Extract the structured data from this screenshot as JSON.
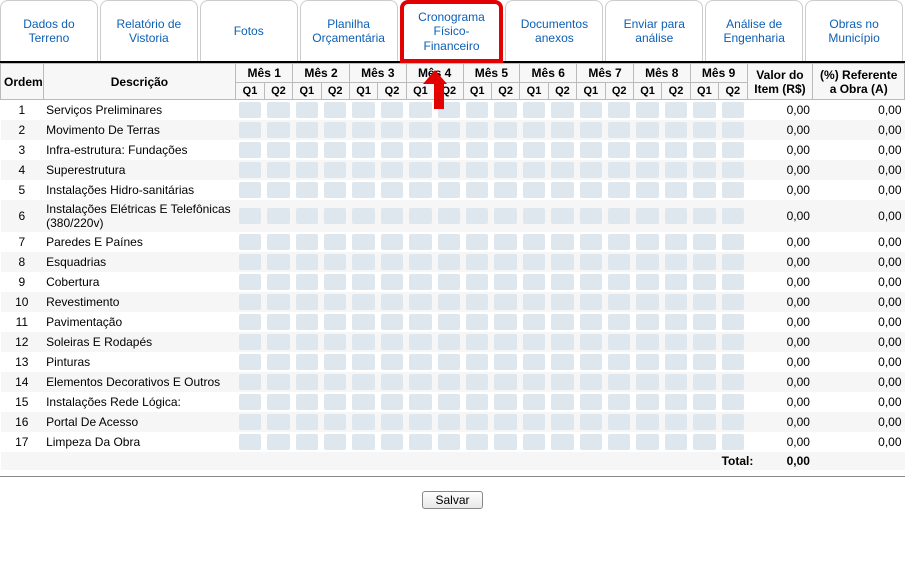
{
  "tabs": [
    {
      "label": "Dados do Terreno"
    },
    {
      "label": "Relatório de Vistoria"
    },
    {
      "label": "Fotos"
    },
    {
      "label": "Planilha Orçamentária"
    },
    {
      "label": "Cronograma Físico-Financeiro",
      "active": true
    },
    {
      "label": "Documentos anexos"
    },
    {
      "label": "Enviar para análise"
    },
    {
      "label": "Análise de Engenharia"
    },
    {
      "label": "Obras no Município"
    }
  ],
  "headers": {
    "ordem": "Ordem",
    "descricao": "Descrição",
    "meses": [
      "Mês 1",
      "Mês 2",
      "Mês 3",
      "Mês 4",
      "Mês 5",
      "Mês 6",
      "Mês 7",
      "Mês 8",
      "Mês 9"
    ],
    "quinzenas": [
      "Q1",
      "Q2"
    ],
    "valor": "Valor do Item (R$)",
    "referente": "(%) Referente a Obra (A)"
  },
  "rows": [
    {
      "ordem": "1",
      "descricao": "Serviços Preliminares",
      "valor": "0,00",
      "ref": "0,00"
    },
    {
      "ordem": "2",
      "descricao": "Movimento De Terras",
      "valor": "0,00",
      "ref": "0,00"
    },
    {
      "ordem": "3",
      "descricao": "Infra-estrutura: Fundações",
      "valor": "0,00",
      "ref": "0,00"
    },
    {
      "ordem": "4",
      "descricao": "Superestrutura",
      "valor": "0,00",
      "ref": "0,00"
    },
    {
      "ordem": "5",
      "descricao": "Instalações Hidro-sanitárias",
      "valor": "0,00",
      "ref": "0,00"
    },
    {
      "ordem": "6",
      "descricao": "Instalações Elétricas E Telefônicas (380/220v)",
      "valor": "0,00",
      "ref": "0,00"
    },
    {
      "ordem": "7",
      "descricao": "Paredes E Paínes",
      "valor": "0,00",
      "ref": "0,00"
    },
    {
      "ordem": "8",
      "descricao": "Esquadrias",
      "valor": "0,00",
      "ref": "0,00"
    },
    {
      "ordem": "9",
      "descricao": "Cobertura",
      "valor": "0,00",
      "ref": "0,00"
    },
    {
      "ordem": "10",
      "descricao": "Revestimento",
      "valor": "0,00",
      "ref": "0,00"
    },
    {
      "ordem": "11",
      "descricao": "Pavimentação",
      "valor": "0,00",
      "ref": "0,00"
    },
    {
      "ordem": "12",
      "descricao": "Soleiras E Rodapés",
      "valor": "0,00",
      "ref": "0,00"
    },
    {
      "ordem": "13",
      "descricao": "Pinturas",
      "valor": "0,00",
      "ref": "0,00"
    },
    {
      "ordem": "14",
      "descricao": "Elementos Decorativos E Outros",
      "valor": "0,00",
      "ref": "0,00"
    },
    {
      "ordem": "15",
      "descricao": "Instalações Rede Lógica:",
      "valor": "0,00",
      "ref": "0,00"
    },
    {
      "ordem": "16",
      "descricao": "Portal De Acesso",
      "valor": "0,00",
      "ref": "0,00"
    },
    {
      "ordem": "17",
      "descricao": "Limpeza Da Obra",
      "valor": "0,00",
      "ref": "0,00"
    }
  ],
  "total": {
    "label": "Total:",
    "value": "0,00"
  },
  "buttons": {
    "salvar": "Salvar"
  }
}
